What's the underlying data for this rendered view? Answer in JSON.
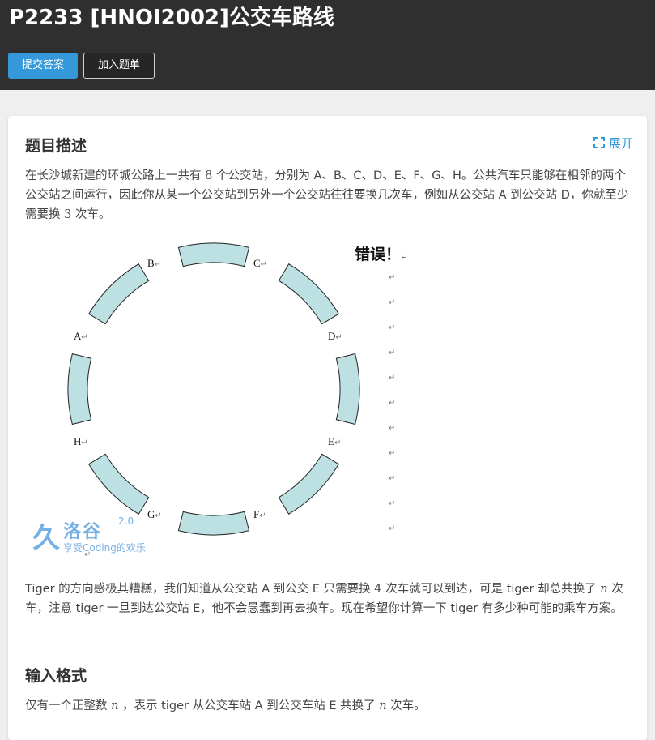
{
  "header": {
    "title": "P2233 [HNOI2002]公交车路线",
    "submit_label": "提交答案",
    "add_label": "加入题单"
  },
  "description": {
    "heading": "题目描述",
    "expand_label": "展开",
    "p1": {
      "t1": "在长沙城新建的环城公路上一共有",
      "v1": "8",
      "t2": "个公交站，分别为 A、B、C、D、E、F、G、H。公共汽车只能够在相邻的两个公交站之间运行，因此你从某一个公交站到另外一个公交站往往要换几次车，例如从公交站 A 到公交站 D，你就至少需要换",
      "v2": "3",
      "t3": "次车。"
    },
    "figure": {
      "stations": [
        "A",
        "B",
        "C",
        "D",
        "E",
        "F",
        "G",
        "H"
      ],
      "return_mark": "↵",
      "error_text": "错误！"
    },
    "p2": {
      "t1": "Tiger 的方向感极其糟糕，我们知道从公交站 A 到公交 E 只需要换",
      "v1": "4",
      "t2": "次车就可以到达，可是 tiger 却总共换了",
      "v2": "n",
      "t3": "次车，注意 tiger 一旦到达公交站 E，他不会愚蠢到再去换车。现在希望你计算一下 tiger 有多少种可能的乘车方案。"
    }
  },
  "watermark": {
    "name": "洛谷",
    "version": "2.0",
    "slogan": "享受Coding的欢乐"
  },
  "input_format": {
    "heading": "输入格式",
    "t1": "仅有一个正整数",
    "v1": "n",
    "t2": "，表示 tiger 从公交车站 A 到公交车站 E 共换了",
    "v2": "n",
    "t3": "次车。"
  },
  "colors": {
    "header_bg": "#2f2f2f",
    "accent": "#3498db",
    "segment_fill": "#bde0e3"
  },
  "icons": {
    "expand": "expand-icon"
  }
}
